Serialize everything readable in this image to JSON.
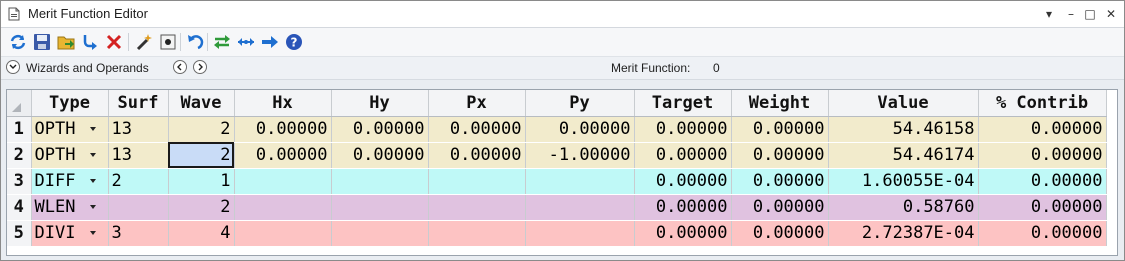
{
  "window": {
    "title": "Merit Function Editor",
    "controls": {
      "menu": "▾",
      "minimize": "–",
      "restore": "□",
      "close": "✕"
    }
  },
  "toolbar": {
    "icons": [
      "refresh-icon",
      "save-icon",
      "load-icon",
      "insert-icon",
      "delete-icon",
      "wand-icon",
      "stop-icon",
      "undo-icon",
      "swap-icon",
      "expand-icon",
      "arrow-right-icon",
      "help-icon"
    ]
  },
  "wizard_bar": {
    "label": "Wizards and Operands",
    "merit_function_label": "Merit Function:",
    "merit_function_value": "0"
  },
  "table": {
    "columns": [
      "Type",
      "Surf",
      "Wave",
      "Hx",
      "Hy",
      "Px",
      "Py",
      "Target",
      "Weight",
      "Value",
      "% Contrib"
    ],
    "rows": [
      {
        "num": "1",
        "bg": "#f2ebcc",
        "type": "OPTH",
        "surf": "13",
        "wave": "2",
        "hx": "0.00000",
        "hy": "0.00000",
        "px": "0.00000",
        "py": "0.00000",
        "target": "0.00000",
        "weight": "0.00000",
        "value": "54.46158",
        "contrib": "0.00000"
      },
      {
        "num": "2",
        "bg": "#f2ebcc",
        "type": "OPTH",
        "surf": "13",
        "wave": "2",
        "hx": "0.00000",
        "hy": "0.00000",
        "px": "0.00000",
        "py": "-1.00000",
        "target": "0.00000",
        "weight": "0.00000",
        "value": "54.46174",
        "contrib": "0.00000"
      },
      {
        "num": "3",
        "bg": "#bff9f7",
        "type": "DIFF",
        "surf": "2",
        "wave": "1",
        "hx": "",
        "hy": "",
        "px": "",
        "py": "",
        "target": "0.00000",
        "weight": "0.00000",
        "value": "1.60055E-04",
        "contrib": "0.00000"
      },
      {
        "num": "4",
        "bg": "#e0c2e0",
        "type": "WLEN",
        "surf": "",
        "wave": "2",
        "hx": "",
        "hy": "",
        "px": "",
        "py": "",
        "target": "0.00000",
        "weight": "0.00000",
        "value": "0.58760",
        "contrib": "0.00000"
      },
      {
        "num": "5",
        "bg": "#fdc3c3",
        "type": "DIVI",
        "surf": "3",
        "wave": "4",
        "hx": "",
        "hy": "",
        "px": "",
        "py": "",
        "target": "0.00000",
        "weight": "0.00000",
        "value": "2.72387E-04",
        "contrib": "0.00000"
      }
    ]
  },
  "colors": {
    "selection": "#c9dcf7",
    "header_bg": "#f3f4f6"
  }
}
